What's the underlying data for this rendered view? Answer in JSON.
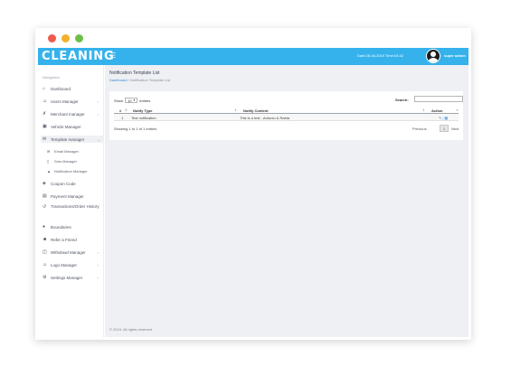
{
  "header": {
    "brand": "CLEANING",
    "menu_icon": "hamburger-icon",
    "datetime": "Date:26-06-2019 Time:03:42",
    "username": "super admin"
  },
  "sidebar": {
    "heading": "Navigation",
    "items": [
      {
        "label": "Dashboard",
        "icon": "home-icon"
      },
      {
        "label": "Users Manager",
        "icon": "user-icon",
        "chevron": "›"
      },
      {
        "label": "Merchant manager",
        "icon": "tools-icon",
        "chevron": "›"
      },
      {
        "label": "Vehicle Manager",
        "icon": "car-icon"
      },
      {
        "label": "Template manager",
        "icon": "mail-icon",
        "chevron": "⌄"
      },
      {
        "label": "Email Manager",
        "icon": "envelope-icon"
      },
      {
        "label": "Sms Manager",
        "icon": "phone-icon"
      },
      {
        "label": "Notification Manager",
        "icon": "bell-icon"
      },
      {
        "label": "Coupon Code",
        "icon": "tag-icon"
      },
      {
        "label": "Payment Manager",
        "icon": "card-icon"
      },
      {
        "label": "Transactions/Order History",
        "icon": "history-icon"
      },
      {
        "label": "Boundaries",
        "icon": "map-pin-icon"
      },
      {
        "label": "Refer a Friend",
        "icon": "user-plus-icon"
      },
      {
        "label": "Withdrawl Manager",
        "icon": "wallet-icon",
        "chevron": "›"
      },
      {
        "label": "Logo Manager",
        "icon": "person-icon",
        "chevron": "›"
      },
      {
        "label": "Settings Manager",
        "icon": "gear-icon",
        "chevron": "›"
      }
    ]
  },
  "page": {
    "title": "Notification Template List",
    "breadcrumb_link": "Dashboard",
    "breadcrumb_sep": "/",
    "breadcrumb_current": "Notification Template List"
  },
  "table": {
    "show_label": "Show",
    "page_size": "10",
    "entries_label": "entries",
    "search_label": "Search:",
    "search_value": "",
    "columns": [
      "#",
      "Notify Type",
      "Notify Content",
      "Action"
    ],
    "rows": [
      {
        "num": "1",
        "type": "Test notification",
        "content": "This is a test. -Antonio & Rabia"
      }
    ],
    "info": "Showing 1 to 1 of 1 entries",
    "prev": "Previous",
    "page": "1",
    "next": "Next"
  },
  "footer": {
    "text": "© 2019. All rights reserved."
  },
  "colors": {
    "accent": "#35b2ec",
    "content_bg": "#eef0f4"
  }
}
